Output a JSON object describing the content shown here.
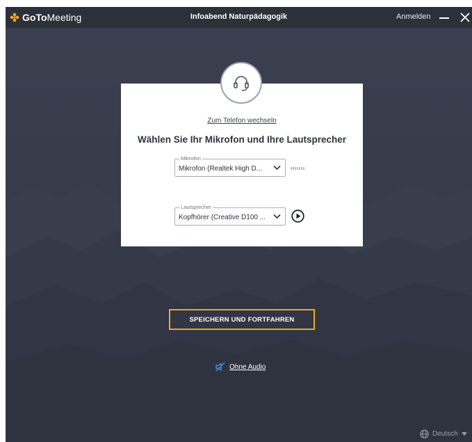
{
  "app": {
    "brand_bold": "GoTo",
    "brand_light": "Meeting",
    "window_title": "Infoabend Naturpädagogik",
    "signin_label": "Anmelden"
  },
  "dialog": {
    "switch_link": "Zum Telefon wechseln",
    "heading": "Wählen Sie Ihr Mikrofon und Ihre Lautsprecher",
    "microphone": {
      "legend": "Mikrofon",
      "value": "Mikrofon (Realtek High D..."
    },
    "speaker": {
      "legend": "Lautsprecher",
      "value": "Kopfhörer (Creative D100 ..."
    }
  },
  "actions": {
    "save_continue": "SPEICHERN UND FORTFAHREN",
    "no_audio": "Ohne Audio"
  },
  "footer": {
    "language": "Deutsch"
  },
  "colors": {
    "accent": "#f2a81d",
    "link_blue": "#4a8fd8",
    "titlebar": "#2c3039",
    "background": "#373c4b"
  },
  "icons": {
    "logo": "gotomeeting-logo-icon",
    "minimize": "minimize-icon",
    "close": "close-icon",
    "headset": "headset-icon",
    "chevron": "chevron-down-icon",
    "mic_level": "mic-level-icon",
    "play": "play-icon",
    "speaker_muted": "speaker-muted-icon",
    "globe": "globe-icon"
  }
}
